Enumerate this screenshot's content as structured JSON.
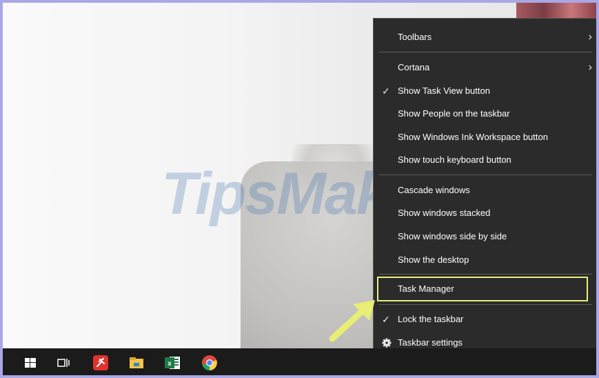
{
  "context_menu": {
    "items": [
      {
        "label": "Toolbars",
        "submenu": true
      },
      {
        "label": "Cortana",
        "submenu": true
      },
      {
        "label": "Show Task View button",
        "checked": true
      },
      {
        "label": "Show People on the taskbar"
      },
      {
        "label": "Show Windows Ink Workspace button"
      },
      {
        "label": "Show touch keyboard button"
      },
      {
        "label": "Cascade windows"
      },
      {
        "label": "Show windows stacked"
      },
      {
        "label": "Show windows side by side"
      },
      {
        "label": "Show the desktop"
      },
      {
        "label": "Task Manager",
        "highlighted": true
      },
      {
        "label": "Lock the taskbar",
        "checked": true
      },
      {
        "label": "Taskbar settings",
        "icon": "gear-icon"
      }
    ],
    "check_glyph": "✓",
    "submenu_glyph": "›"
  },
  "watermark": {
    "text": "TipsMake"
  },
  "taskbar": {
    "icons": [
      {
        "name": "start-icon"
      },
      {
        "name": "task-view-icon"
      },
      {
        "name": "pinned-app-icon"
      },
      {
        "name": "file-explorer-icon"
      },
      {
        "name": "excel-icon"
      },
      {
        "name": "chrome-icon"
      }
    ]
  },
  "colors": {
    "menu_bg": "#2b2b2b",
    "highlight_border": "#ecf07a",
    "frame": "#a9a7e6",
    "taskbar": "#1b1b1b"
  }
}
